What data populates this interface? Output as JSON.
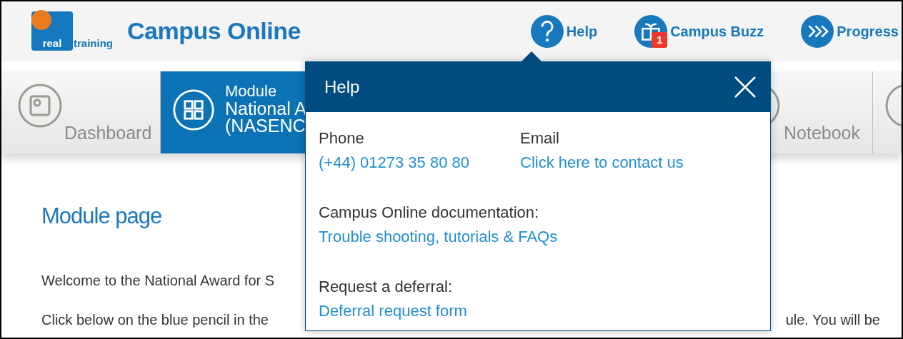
{
  "header": {
    "logo_text_1": "real",
    "logo_text_2": "training",
    "title": "Campus Online"
  },
  "nav": [
    {
      "kind": "help",
      "label": "Help",
      "expanded": true
    },
    {
      "kind": "buzz",
      "label": "Campus Buzz",
      "badge": "1"
    },
    {
      "kind": "progress",
      "label": "Progress"
    }
  ],
  "tabs": [
    {
      "kind": "dashboard",
      "label": "Dashboard",
      "selected": false
    },
    {
      "kind": "module",
      "overline": "Module",
      "lines": [
        "National A",
        "(NASENC"
      ],
      "selected": true
    },
    {
      "kind": "notebook",
      "label": "Notebook",
      "selected": false
    },
    {
      "kind": "other",
      "selected": false
    }
  ],
  "main": {
    "heading": "Module page",
    "paragraph_1": "Welcome to the National Award for S",
    "paragraph_2_left": "Click below on the blue pencil in the",
    "paragraph_2_right": "ule. You will be"
  },
  "popup": {
    "title": "Help",
    "contacts": [
      {
        "label": "Phone",
        "link": "(+44) 01273 35 80 80"
      },
      {
        "label": "Email",
        "link": "Click here to contact us"
      }
    ],
    "sections": [
      {
        "label": "Campus Online documentation:",
        "link": "Trouble shooting, tutorials & FAQs"
      },
      {
        "label": "Request a deferral:",
        "link": "Deferral request form"
      }
    ]
  }
}
